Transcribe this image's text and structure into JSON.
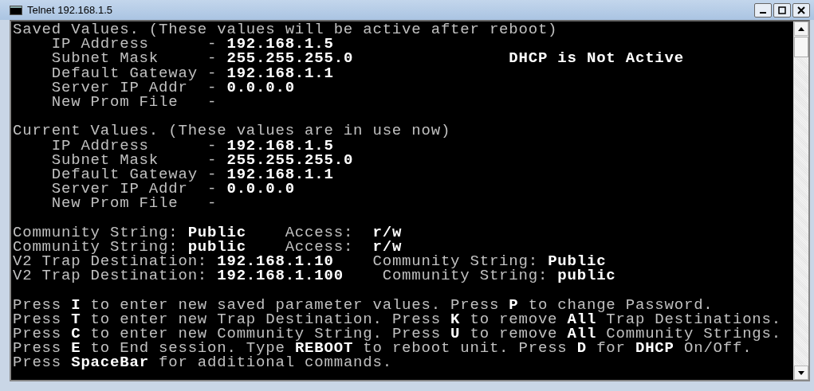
{
  "window": {
    "title": "Telnet 192.168.1.5"
  },
  "console": {
    "blocks": [
      {
        "lines": [
          "Saved Values. (These values will be active after reboot)",
          "    IP Address      - **192.168.1.5**",
          "    Subnet Mask     - **255.255.255.0**                **DHCP is Not Active**",
          "    Default Gateway - **192.168.1.1**",
          "    Server IP Addr  - **0.0.0.0**",
          "    New Prom File   -"
        ]
      },
      {
        "lines": [
          "Current Values. (These values are in use now)",
          "    IP Address      - **192.168.1.5**",
          "    Subnet Mask     - **255.255.255.0**",
          "    Default Gateway - **192.168.1.1**",
          "    Server IP Addr  - **0.0.0.0**",
          "    New Prom File   -"
        ]
      },
      {
        "lines": [
          "Community String: **Public**    Access:  **r/w**",
          "Community String: **public**    Access:  **r/w**",
          "V2 Trap Destination: **192.168.1.10**    Community String: **Public**",
          "V2 Trap Destination: **192.168.1.100**    Community String: **public**"
        ]
      },
      {
        "lines": [
          "Press **I** to enter new saved parameter values. Press **P** to change Password.",
          "Press **T** to enter new Trap Destination. Press **K** to remove **All** Trap Destinations.",
          "Press **C** to enter new Community String. Press **U** to remove **All** Community Strings.",
          "Press **E** to End session. Type **REBOOT** to reboot unit. Press **D** for **DHCP** On/Off.",
          "Press **SpaceBar** for additional commands."
        ]
      }
    ]
  }
}
